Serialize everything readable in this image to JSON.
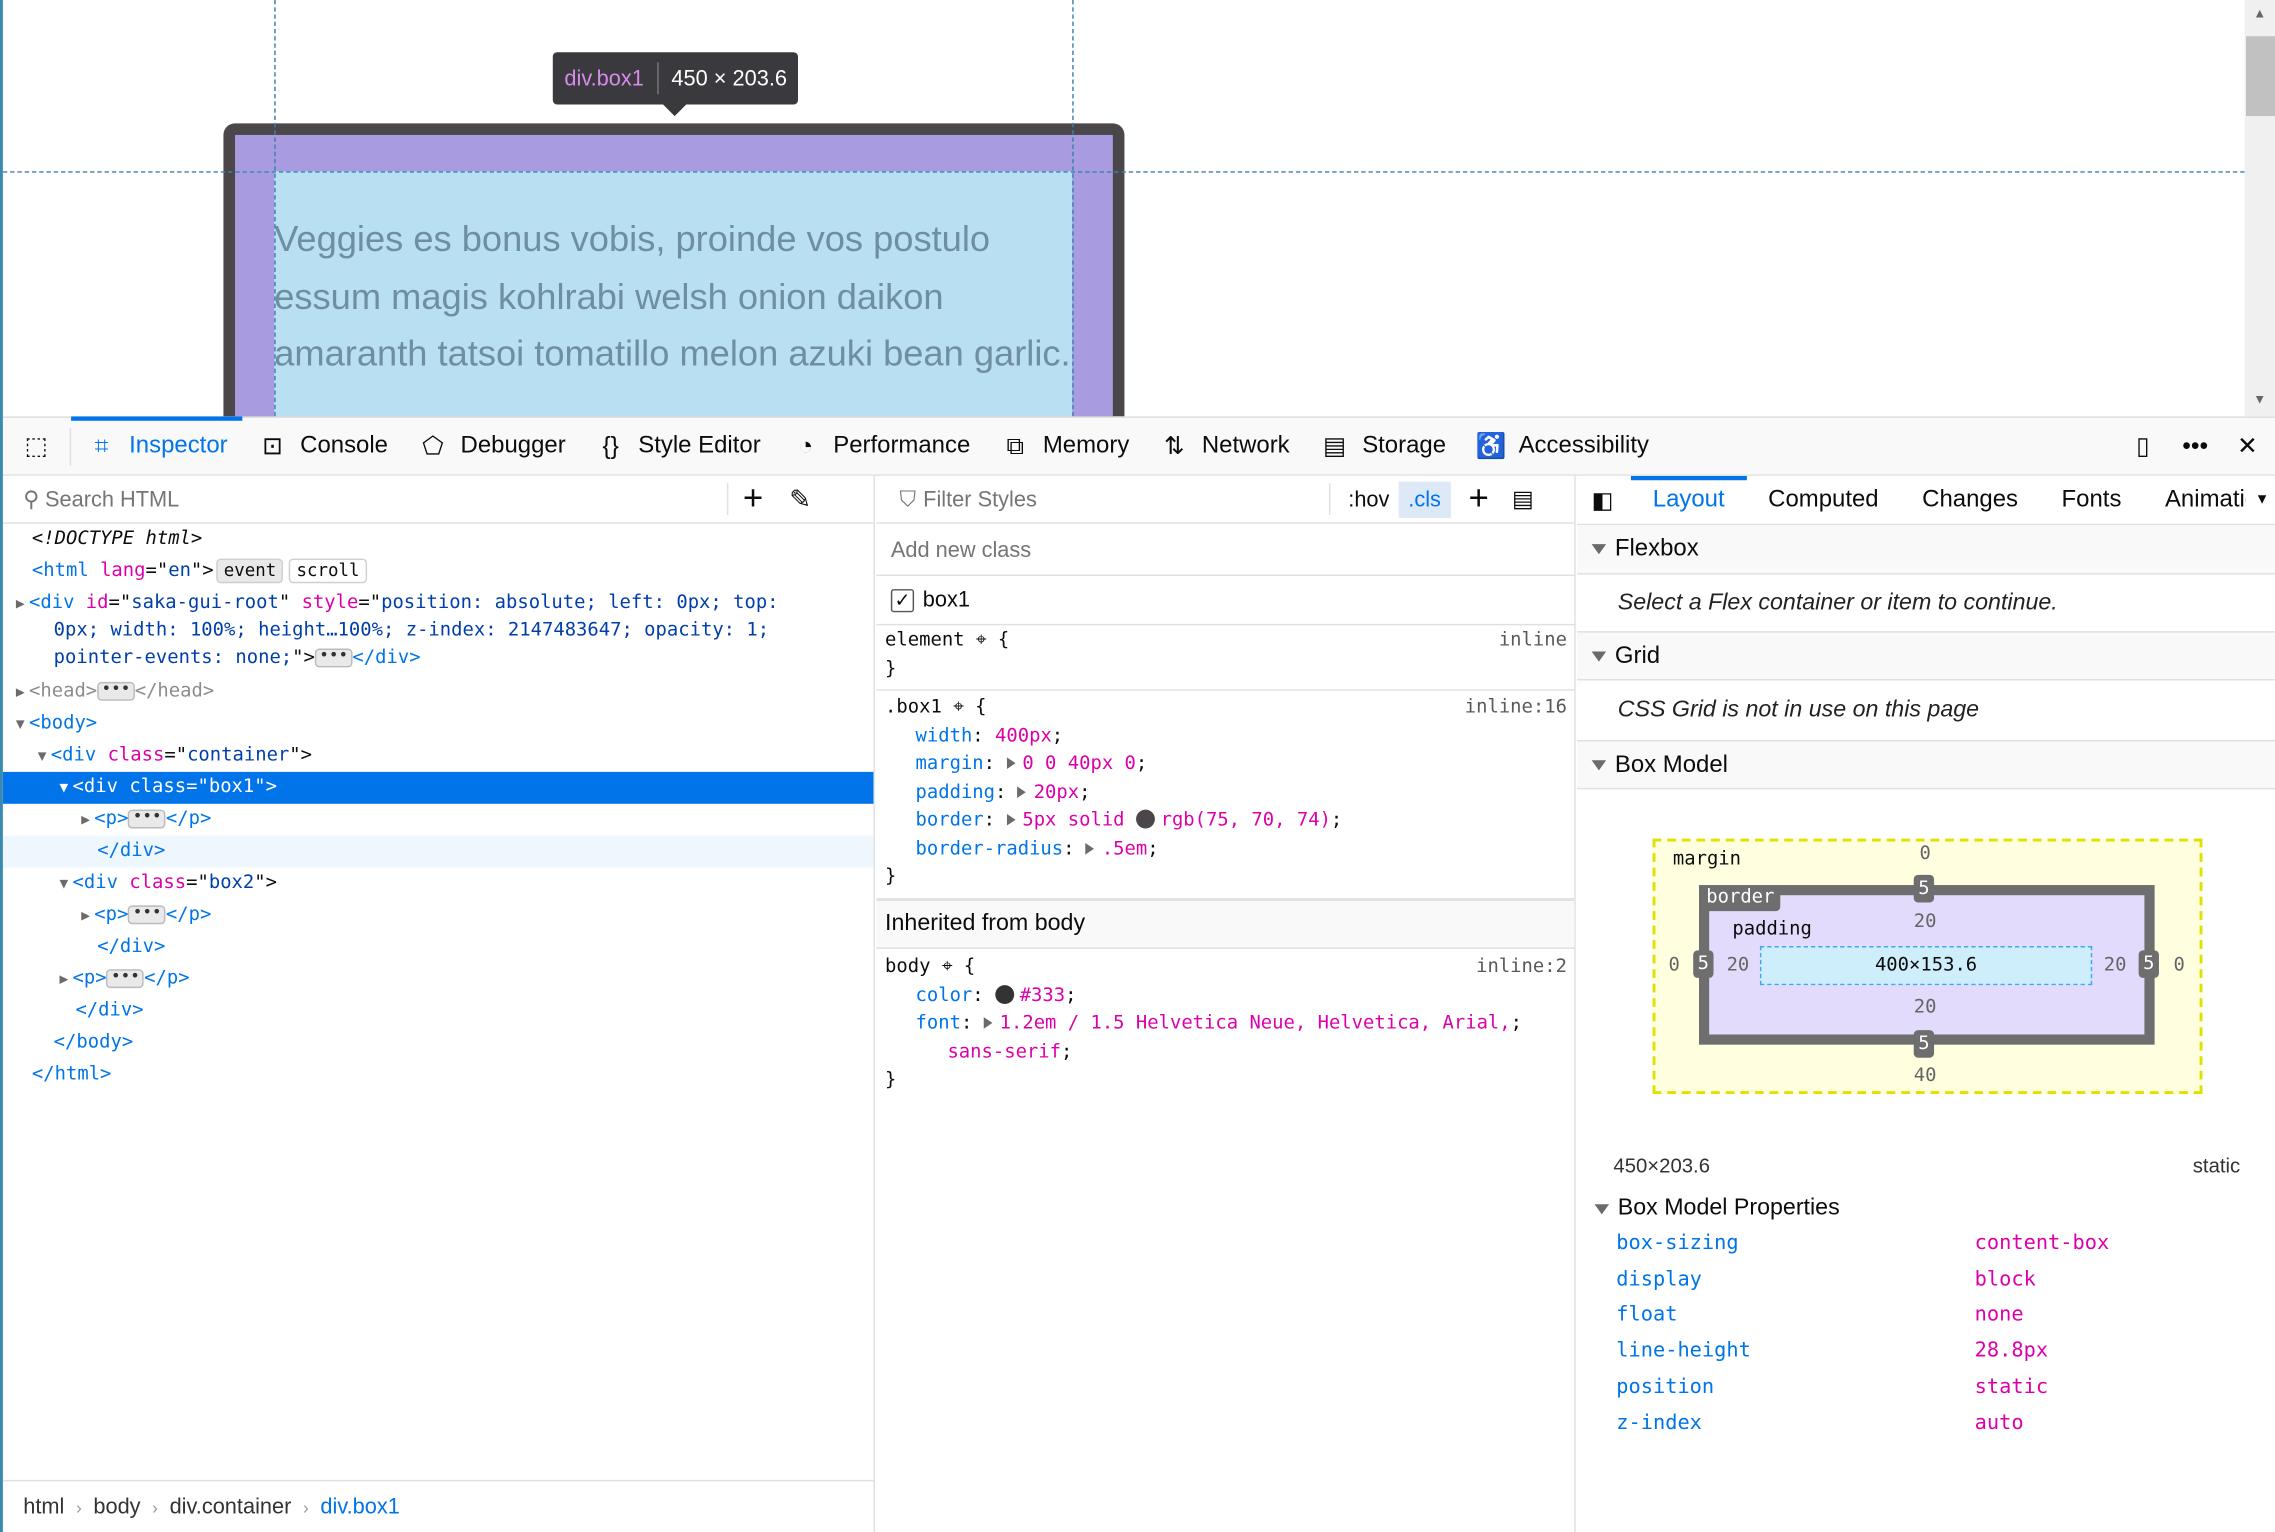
{
  "page": {
    "paragraph": "Veggies es bonus vobis, proinde vos postulo essum magis kohlrabi welsh onion daikon amaranth tatsoi tomatillo melon azuki bean garlic.",
    "tooltip": {
      "selector": "div.box1",
      "size": "450 × 203.6"
    },
    "colors": {
      "border": "#4b464a",
      "padding": "#a89be0",
      "content": "#b8e0f2"
    }
  },
  "toolbar": {
    "tabs": [
      {
        "label": "Inspector",
        "icon": "inspector-icon",
        "active": true
      },
      {
        "label": "Console",
        "icon": "console-icon"
      },
      {
        "label": "Debugger",
        "icon": "debugger-icon"
      },
      {
        "label": "Style Editor",
        "icon": "braces-icon"
      },
      {
        "label": "Performance",
        "icon": "gauge-icon"
      },
      {
        "label": "Memory",
        "icon": "chip-icon"
      },
      {
        "label": "Network",
        "icon": "arrows-updown-icon"
      },
      {
        "label": "Storage",
        "icon": "storage-icon"
      },
      {
        "label": "Accessibility",
        "icon": "accessibility-icon"
      }
    ]
  },
  "markup": {
    "search_placeholder": "Search HTML",
    "rows": [
      {
        "indent": 0,
        "tw": "",
        "tokens": [
          [
            "doc",
            "<!DOCTYPE html>"
          ]
        ]
      },
      {
        "indent": 0,
        "tw": "",
        "tokens": [
          [
            "tag",
            "<html "
          ],
          [
            "an",
            "lang"
          ],
          [
            "txt",
            "=\""
          ],
          [
            "av",
            "en"
          ],
          [
            "txt",
            "\">"
          ],
          [
            "badge",
            "event"
          ],
          [
            "badgeo",
            "scroll"
          ]
        ]
      },
      {
        "indent": 0,
        "tw": "▶",
        "tokens": [
          [
            "tag",
            "<div "
          ],
          [
            "an",
            "id"
          ],
          [
            "txt",
            "=\""
          ],
          [
            "av",
            "saka-gui-root"
          ],
          [
            "txt",
            "\" "
          ],
          [
            "an",
            "style"
          ],
          [
            "txt",
            "=\""
          ],
          [
            "av",
            "position: absolute; left: 0px; top:"
          ]
        ]
      },
      {
        "indent": 1,
        "tw": "",
        "tokens": [
          [
            "av",
            "0px; width: 100%; height…100%; z-index: 2147483647; opacity: 1;"
          ]
        ]
      },
      {
        "indent": 1,
        "tw": "",
        "tokens": [
          [
            "av",
            "pointer-events: none;"
          ],
          [
            "txt",
            "\">"
          ],
          [
            "ell",
            "•••"
          ],
          [
            "tag",
            "</div>"
          ]
        ]
      },
      {
        "indent": 0,
        "tw": "▶",
        "tokens": [
          [
            "dim",
            "<head>"
          ],
          [
            "ell",
            "•••"
          ],
          [
            "dim",
            "</head>"
          ]
        ]
      },
      {
        "indent": 0,
        "tw": "▼",
        "tokens": [
          [
            "tag",
            "<body>"
          ]
        ]
      },
      {
        "indent": 1,
        "tw": "▼",
        "tokens": [
          [
            "tag",
            "<div "
          ],
          [
            "an",
            "class"
          ],
          [
            "txt",
            "=\""
          ],
          [
            "av",
            "container"
          ],
          [
            "txt",
            "\">"
          ]
        ]
      },
      {
        "indent": 2,
        "tw": "▼",
        "state": "selected",
        "tokens": [
          [
            "tag",
            "<div "
          ],
          [
            "an",
            "class"
          ],
          [
            "txt",
            "=\""
          ],
          [
            "av",
            "box1"
          ],
          [
            "txt",
            "\">"
          ]
        ]
      },
      {
        "indent": 3,
        "tw": "▶",
        "tokens": [
          [
            "tag",
            "<p>"
          ],
          [
            "ell",
            "•••"
          ],
          [
            "tag",
            "</p>"
          ]
        ]
      },
      {
        "indent": 3,
        "tw": "",
        "state": "hover",
        "tokens": [
          [
            "tag",
            "</div>"
          ]
        ]
      },
      {
        "indent": 2,
        "tw": "▼",
        "tokens": [
          [
            "tag",
            "<div "
          ],
          [
            "an",
            "class"
          ],
          [
            "txt",
            "=\""
          ],
          [
            "av",
            "box2"
          ],
          [
            "txt",
            "\">"
          ]
        ]
      },
      {
        "indent": 3,
        "tw": "▶",
        "tokens": [
          [
            "tag",
            "<p>"
          ],
          [
            "ell",
            "•••"
          ],
          [
            "tag",
            "</p>"
          ]
        ]
      },
      {
        "indent": 3,
        "tw": "",
        "tokens": [
          [
            "tag",
            "</div>"
          ]
        ]
      },
      {
        "indent": 2,
        "tw": "▶",
        "tokens": [
          [
            "tag",
            "<p>"
          ],
          [
            "ell",
            "•••"
          ],
          [
            "tag",
            "</p>"
          ]
        ]
      },
      {
        "indent": 2,
        "tw": "",
        "tokens": [
          [
            "tag",
            "</div>"
          ]
        ]
      },
      {
        "indent": 1,
        "tw": "",
        "tokens": [
          [
            "tag",
            "</body>"
          ]
        ]
      },
      {
        "indent": 0,
        "tw": "",
        "tokens": [
          [
            "tag",
            "</html>"
          ]
        ]
      }
    ],
    "breadcrumbs": [
      "html",
      "body",
      "div.container",
      "div.box1"
    ]
  },
  "rules": {
    "filter_placeholder": "Filter Styles",
    "hov": ":hov",
    "cls": ".cls",
    "add_class_placeholder": "Add new class",
    "class_checkbox": {
      "label": "box1",
      "checked": true
    },
    "element_rule": {
      "selector": "element",
      "source": "inline"
    },
    "box1_rule": {
      "selector": ".box1",
      "source": "inline:16",
      "decls": [
        {
          "prop": "width",
          "value": "400px"
        },
        {
          "prop": "margin",
          "value": "0 0 40px 0",
          "expand": true
        },
        {
          "prop": "padding",
          "value": "20px",
          "expand": true
        },
        {
          "prop": "border",
          "value": "5px solid",
          "expand": true,
          "swatch": "#4b464a",
          "value2": "rgb(75, 70, 74)"
        },
        {
          "prop": "border-radius",
          "value": ".5em",
          "expand": true
        }
      ]
    },
    "inherited_header": "Inherited from body",
    "body_rule": {
      "selector": "body",
      "source": "inline:2",
      "decls": [
        {
          "prop": "color",
          "value": "#333",
          "swatch": "#333333"
        },
        {
          "prop": "font",
          "value": "1.2em / 1.5 Helvetica Neue, Helvetica, Arial,",
          "expand": true,
          "cont": "sans-serif"
        }
      ]
    }
  },
  "layout": {
    "tabs": [
      "Layout",
      "Computed",
      "Changes",
      "Fonts",
      "Animatio"
    ],
    "flexbox": {
      "title": "Flexbox",
      "note": "Select a Flex container or item to continue."
    },
    "grid": {
      "title": "Grid",
      "note": "CSS Grid is not in use on this page"
    },
    "boxmodel": {
      "title": "Box Model",
      "margin_label": "margin",
      "border_label": "border",
      "padding_label": "padding",
      "margin": {
        "top": "0",
        "right": "0",
        "bottom": "40",
        "left": "0"
      },
      "border": {
        "top": "5",
        "right": "5",
        "bottom": "5",
        "left": "5"
      },
      "padding": {
        "top": "20",
        "right": "20",
        "bottom": "20",
        "left": "20"
      },
      "content": "400×153.6",
      "size": "450×203.6",
      "position": "static"
    },
    "properties_title": "Box Model Properties",
    "properties": [
      {
        "name": "box-sizing",
        "value": "content-box"
      },
      {
        "name": "display",
        "value": "block"
      },
      {
        "name": "float",
        "value": "none"
      },
      {
        "name": "line-height",
        "value": "28.8px"
      },
      {
        "name": "position",
        "value": "static"
      },
      {
        "name": "z-index",
        "value": "auto"
      }
    ]
  }
}
